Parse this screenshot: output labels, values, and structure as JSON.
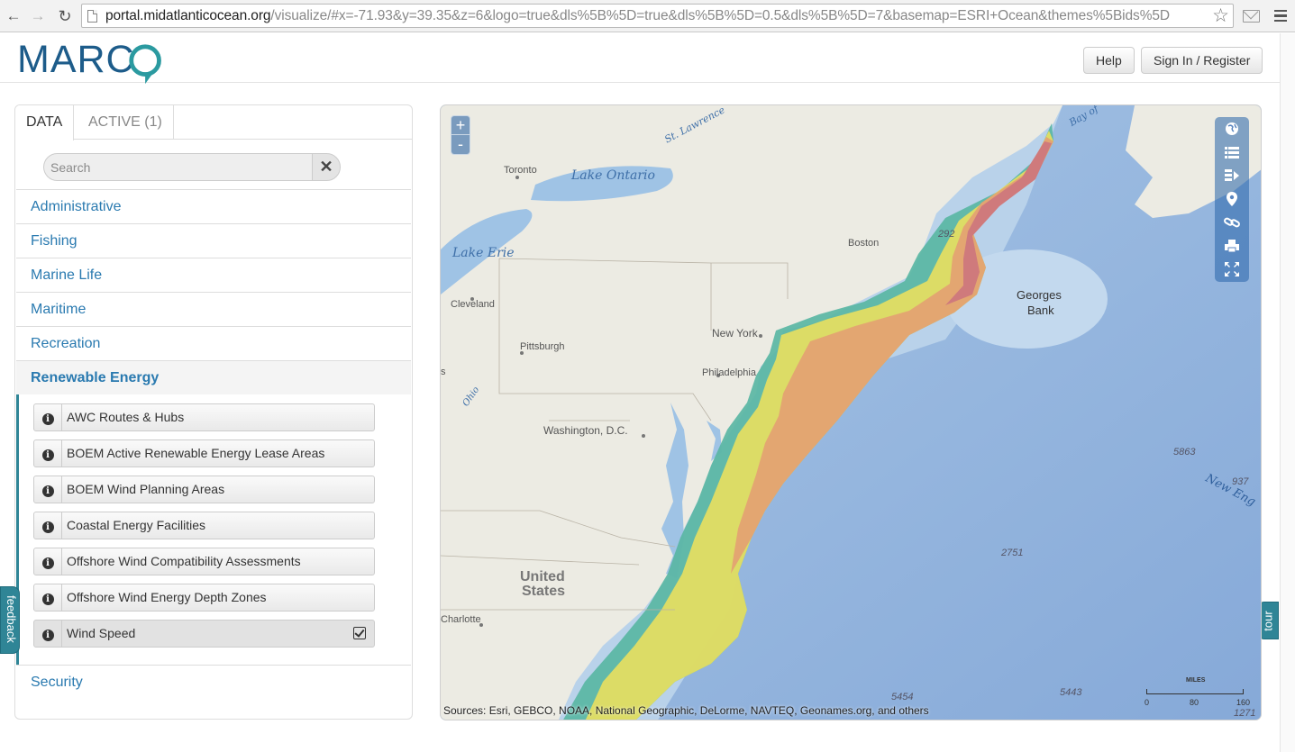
{
  "browser": {
    "url_domain": "portal.midatlanticocean.org",
    "url_rest": "/visualize/#x=-71.93&y=39.35&z=6&logo=true&dls%5B%5D=true&dls%5B%5D=0.5&dls%5B%5D=7&basemap=ESRI+Ocean&themes%5Bids%5D"
  },
  "header": {
    "logo_text": "MARC",
    "help_label": "Help",
    "signin_label": "Sign In / Register"
  },
  "panel": {
    "tabs": [
      {
        "label": "DATA"
      },
      {
        "label": "ACTIVE (1)"
      }
    ],
    "search": {
      "placeholder": "Search",
      "clear_symbol": "✕"
    },
    "themes": [
      {
        "label": "Administrative"
      },
      {
        "label": "Fishing"
      },
      {
        "label": "Marine Life"
      },
      {
        "label": "Maritime"
      },
      {
        "label": "Recreation"
      },
      {
        "label": "Renewable Energy"
      },
      {
        "label": "Security"
      }
    ],
    "layers": [
      {
        "label": "AWC Routes & Hubs"
      },
      {
        "label": "BOEM Active Renewable Energy Lease Areas"
      },
      {
        "label": "BOEM Wind Planning Areas"
      },
      {
        "label": "Coastal Energy Facilities"
      },
      {
        "label": "Offshore Wind Compatibility Assessments"
      },
      {
        "label": "Offshore Wind Energy Depth Zones"
      },
      {
        "label": "Wind Speed"
      }
    ],
    "info_symbol": "i"
  },
  "side_tabs": {
    "feedback": "feedback",
    "tour": "tour"
  },
  "map": {
    "zoom_in": "+",
    "zoom_out": "-",
    "attribution": "Sources: Esri, GEBCO, NOAA, National Geographic, DeLorme, NAVTEQ, Geonames.org, and others",
    "scale": {
      "unit": "MILES",
      "ticks": [
        "0",
        "80",
        "160"
      ]
    },
    "labels": {
      "st_lawrence": "St. Lawrence",
      "bay_of": "Bay of",
      "toronto": "Toronto",
      "lake_ontario": "Lake Ontario",
      "lake_erie": "Lake Erie",
      "boston": "Boston",
      "cleveland": "Cleveland",
      "pittsburgh": "Pittsburgh",
      "new_york": "New York",
      "philadelphia": "Philadelphia",
      "washington": "Washington, D.C.",
      "ohio": "Ohio",
      "charlotte": "Charlotte",
      "united": "United",
      "states": "States",
      "georges": "Georges",
      "bank": "Bank",
      "new_eng": "New Eng",
      "d292": "292",
      "d5863": "5863",
      "d937": "937",
      "d2751": "2751",
      "d5454": "5454",
      "d5443": "5443",
      "d1271": "1271",
      "s_mark": "s"
    },
    "colors": {
      "ocean_shallow": "#b8d3ea",
      "ocean_deep": "#8fb2dc",
      "land": "#ece9e0",
      "wind_low": "#3fa7a5",
      "wind_mid": "#e5df5e",
      "wind_high": "#d78a6e",
      "wind_max": "#cf7a7c"
    }
  }
}
